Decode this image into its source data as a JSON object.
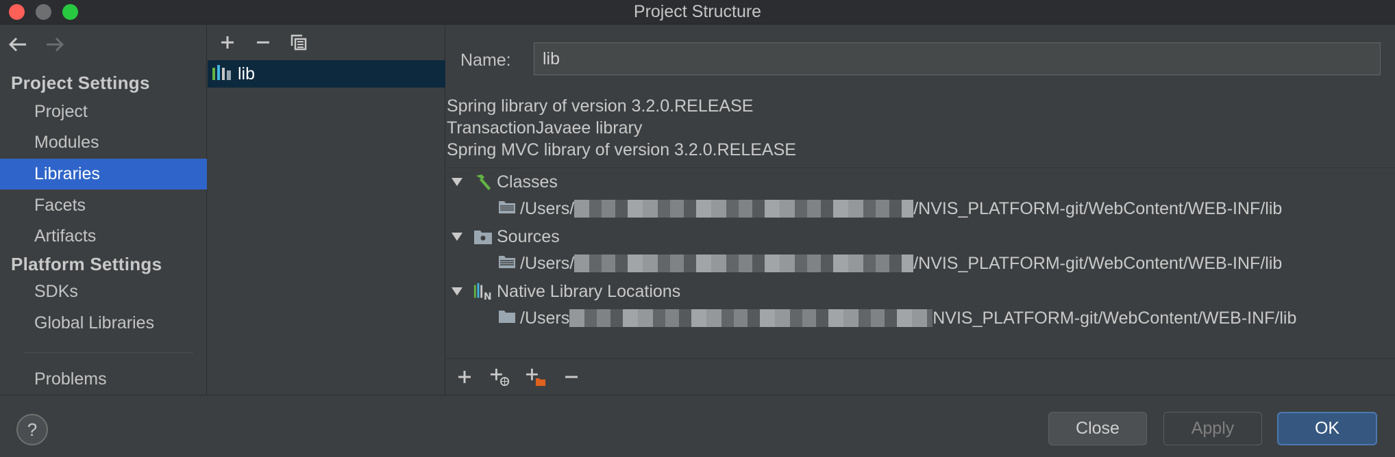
{
  "window": {
    "title": "Project Structure"
  },
  "nav": {
    "back_icon": "arrow-left-icon",
    "forward_icon": "arrow-right-icon",
    "project_settings_header": "Project Settings",
    "project_items": [
      "Project",
      "Modules",
      "Libraries",
      "Facets",
      "Artifacts"
    ],
    "platform_settings_header": "Platform Settings",
    "platform_items": [
      "SDKs",
      "Global Libraries"
    ],
    "problems": "Problems",
    "active_item": "Libraries"
  },
  "library_list": {
    "toolbar_icons": [
      "plus-icon",
      "minus-icon",
      "copy-icon"
    ],
    "items": [
      {
        "label": "lib",
        "icon": "library-icon",
        "selected": true
      }
    ]
  },
  "details": {
    "name_label": "Name:",
    "name_value": "lib",
    "description_lines": [
      "Spring library of version 3.2.0.RELEASE",
      "TransactionJavaee library",
      "Spring MVC library of version 3.2.0.RELEASE"
    ],
    "tree": [
      {
        "label": "Classes",
        "icon": "hammer-icon",
        "path_prefix": "/Users/",
        "path_suffix": "/NVIS_PLATFORM-git/WebContent/WEB-INF/lib"
      },
      {
        "label": "Sources",
        "icon": "source-folder-icon",
        "path_prefix": "/Users/",
        "path_suffix": "/NVIS_PLATFORM-git/WebContent/WEB-INF/lib"
      },
      {
        "label": "Native Library Locations",
        "icon": "native-library-icon",
        "path_prefix": "/Users",
        "path_suffix": "NVIS_PLATFORM-git/WebContent/WEB-INF/lib"
      }
    ],
    "bottom_tools": [
      "plus-icon",
      "add-url-icon",
      "add-folder-icon",
      "minus-icon"
    ]
  },
  "footer": {
    "help": "?",
    "close": "Close",
    "apply": "Apply",
    "ok": "OK"
  },
  "colors": {
    "accent": "#2f65ca",
    "selection": "#0d293e",
    "ok_button": "#365880"
  }
}
